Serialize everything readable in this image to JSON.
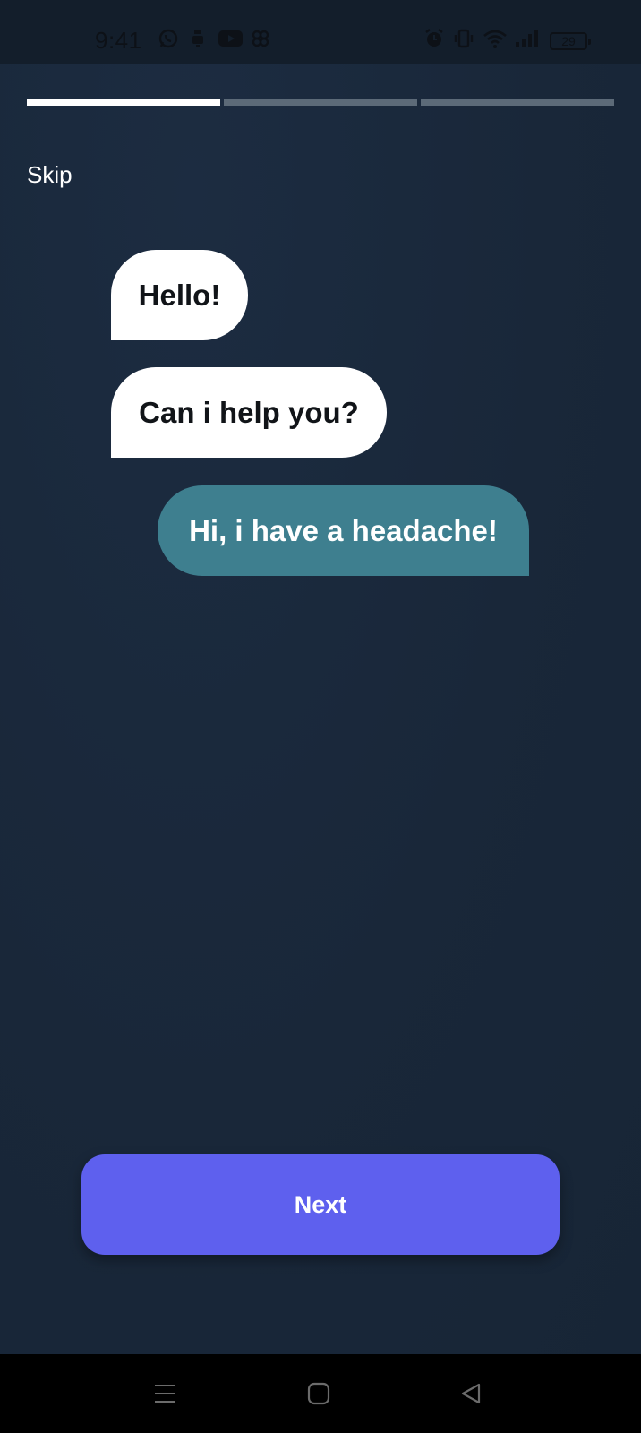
{
  "status_bar": {
    "time": "9:41",
    "battery_level": "29",
    "icons": [
      "whatsapp-icon",
      "notification-icon",
      "youtube-icon",
      "app-icon",
      "alarm-icon",
      "vibrate-icon",
      "wifi-icon",
      "signal-icon",
      "battery-icon"
    ]
  },
  "onboarding": {
    "progress_steps": 3,
    "current_step": 1,
    "skip_label": "Skip",
    "messages": [
      {
        "text": "Hello!",
        "sender": "bot"
      },
      {
        "text": "Can i help you?",
        "sender": "bot"
      },
      {
        "text": "Hi, i have a headache!",
        "sender": "user"
      }
    ],
    "next_label": "Next"
  },
  "nav_bar": {
    "icons": [
      "menu-icon",
      "home-icon",
      "back-icon"
    ]
  },
  "colors": {
    "background": "#19273a",
    "bot_bubble": "#ffffff",
    "user_bubble": "#3e7f8f",
    "accent_button": "#5e60ee",
    "progress_active": "#ffffff",
    "progress_inactive": "#5c6a78"
  }
}
